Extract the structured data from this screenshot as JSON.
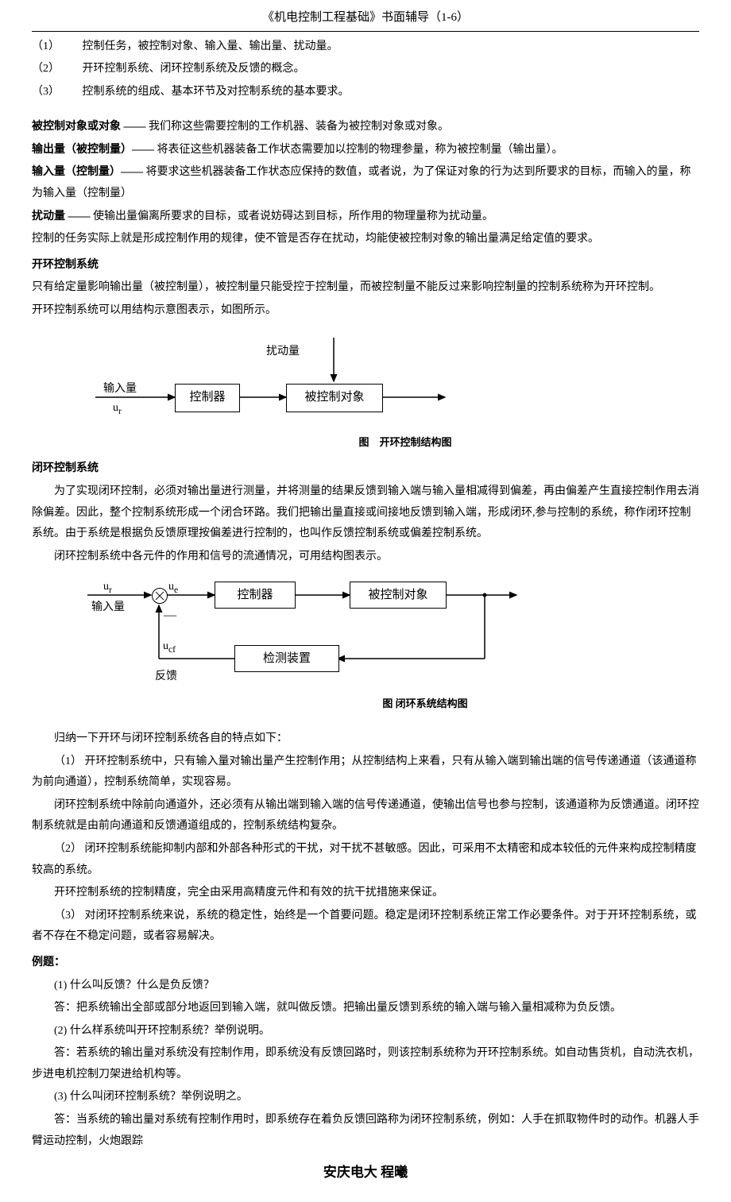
{
  "header": "《机电控制工程基础》书面辅导（1-6）",
  "items": [
    {
      "num": "（1）",
      "text": "控制任务，被控制对象、输入量、输出量、扰动量。"
    },
    {
      "num": "（2）",
      "text": "开环控制系统、闭环控制系统及反馈的概念。"
    },
    {
      "num": "（3）",
      "text": "控制系统的组成、基本环节及对控制系统的基本要求。"
    }
  ],
  "defs": [
    {
      "term": "被控制对象或对象 —— ",
      "text": "我们称这些需要控制的工作机器、装备为被控制对象或对象。"
    },
    {
      "term": "输出量（被控制量）—— ",
      "text": "将表征这些机器装备工作状态需要加以控制的物理参量，称为被控制量（输出量）。"
    },
    {
      "term": "输入量（控制量）—— ",
      "text": "将要求这些机器装备工作状态应保持的数值，或者说，为了保证对象的行为达到所要求的目标，而输入的量，称为输入量（控制量）"
    },
    {
      "term": "扰动量 —— ",
      "text": "使输出量偏离所要求的目标，或者说妨碍达到目标，所作用的物理量称为扰动量。"
    }
  ],
  "p_ctrl_task": "控制的任务实际上就是形成控制作用的规律，使不管是否存在扰动，均能使被控制对象的输出量满足给定值的要求。",
  "h_open": "开环控制系统",
  "p_open1": "只有给定量影响输出量（被控制量），被控制量只能受控于控制量，而被控制量不能反过来影响控制量的控制系统称为开环控制。",
  "p_open2": "开环控制系统可以用结构示意图表示，如图所示。",
  "d1": {
    "disturb": "扰动量",
    "input": "输入量",
    "ur": "u",
    "ur_sub": "r",
    "controller": "控制器",
    "plant": "被控制对象"
  },
  "fig1": "图　开环控制结构图",
  "h_closed": "闭环控制系统",
  "p_closed1": "为了实现闭环控制，必须对输出量进行测量，并将测量的结果反馈到输入端与输入量相减得到偏差，再由偏差产生直接控制作用去消除偏差。因此，整个控制系统形成一个闭合环路。我们把输出量直接或间接地反馈到输入端，形成闭环,参与控制的系统，称作闭环控制系统。由于系统是根据负反馈原理按偏差进行控制的，也叫作反馈控制系统或偏差控制系统。",
  "p_closed2": "闭环控制系统中各元件的作用和信号的流通情况，可用结构图表示。",
  "d2": {
    "ur": "u",
    "ur_sub": "r",
    "input": "输入量",
    "ue": "u",
    "ue_sub": "e",
    "controller": "控制器",
    "plant": "被控制对象",
    "ucf": "u",
    "ucf_sub": "cf",
    "feedback": "反馈",
    "minus": "—",
    "sensor": "检测装置"
  },
  "fig2": "图  闭环系统结构图",
  "p_summary": "归纳一下开环与闭环控制系统各自的特点如下：",
  "p_s1": "（1） 开环控制系统中，只有输入量对输出量产生控制作用；从控制结构上来看，只有从输入端到输出端的信号传递通道（该通道称为前向通道），控制系统简单，实现容易。",
  "p_s1b": "闭环控制系统中除前向通道外，还必须有从输出端到输入端的信号传递通道，使输出信号也参与控制，该通道称为反馈通道。闭环控制系统就是由前向通道和反馈通道组成的，控制系统结构复杂。",
  "p_s2": "（2） 闭环控制系统能抑制内部和外部各种形式的干扰，对干扰不甚敏感。因此，可采用不太精密和成本较低的元件来构成控制精度较高的系统。",
  "p_s2b": "开环控制系统的控制精度，完全由采用高精度元件和有效的抗干扰措施来保证。",
  "p_s3": "（3） 对闭环控制系统来说，系统的稳定性，始终是一个首要问题。稳定是闭环控制系统正常工作必要条件。对于开环控制系统，或者不存在不稳定问题，或者容易解决。",
  "h_examples": "例题：",
  "q1": "(1) 什么叫反馈？什么是负反馈？",
  "a1": "答：把系统输出全部或部分地返回到输入端，就叫做反馈。把输出量反馈到系统的输入端与输入量相减称为负反馈。",
  "q2": "(2) 什么样系统叫开环控制系统？举例说明。",
  "a2": "答：若系统的输出量对系统没有控制作用，即系统没有反馈回路时，则该控制系统称为开环控制系统。如自动售货机，自动洗衣机，步进电机控制刀架进给机构等。",
  "q3": "(3) 什么叫闭环控制系统？举例说明之。",
  "a3": "答：当系统的输出量对系统有控制作用时，即系统存在着负反馈回路称为闭环控制系统，例如：人手在抓取物件时的动作。机器人手臂运动控制，火炮跟踪",
  "footer": "安庆电大  程曦"
}
